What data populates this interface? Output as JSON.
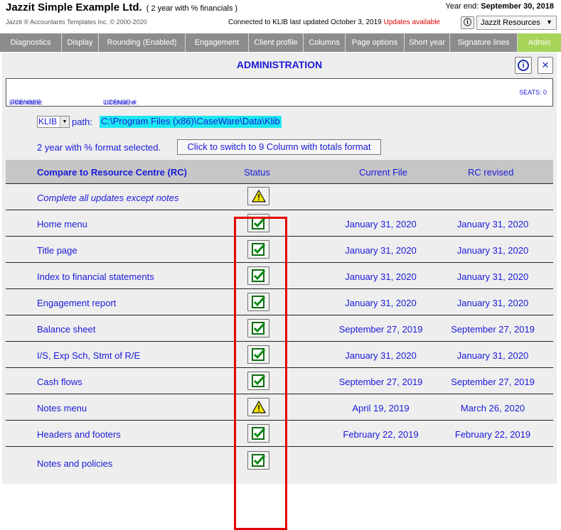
{
  "header": {
    "company": "Jazzit Simple Example Ltd.",
    "company_sub": "( 2 year with % financials )",
    "copyright": "Jazzit ® Accountants Templates Inc. © 2000-2020",
    "year_end_label": "Year end:",
    "year_end_value": "September 30, 2018",
    "connection": "Connected to KLIB last updated October 3, 2019",
    "updates": "Updates available",
    "info_icon": "ⓘ",
    "resources_select": "Jazzit Resources"
  },
  "tabs": [
    {
      "label": "Diagnostics"
    },
    {
      "label": "Display"
    },
    {
      "label": "Rounding (Enabled)"
    },
    {
      "label": "Engagement"
    },
    {
      "label": "Client profile"
    },
    {
      "label": "Columns"
    },
    {
      "label": "Page options"
    },
    {
      "label": "Short year"
    },
    {
      "label": "Signature lines"
    },
    {
      "label": "Admin"
    }
  ],
  "admin": {
    "title": "ADMINISTRATION",
    "info_glyph": "i",
    "close_glyph": "✕"
  },
  "license": {
    "licensee_label": "LICENSEE:",
    "licensee_value": "Firm name",
    "license_no_label": "LICENSE #:",
    "license_no_value": "License no",
    "seats": "SEATS: 0"
  },
  "klib": {
    "select_value": "KLIB",
    "path_label": "path:",
    "path_value": "C:\\Program Files (x86)\\CaseWare\\Data\\Klib"
  },
  "format": {
    "text": "2 year with % format selected.",
    "switch_button": "Click to switch to 9 Column with totals format"
  },
  "table": {
    "headers": {
      "name": "Compare to Resource Centre (RC)",
      "status": "Status",
      "current": "Current File",
      "rc": "RC revised"
    },
    "rows": [
      {
        "name": "Complete all updates except notes",
        "status": "warning",
        "current": "",
        "rc": ""
      },
      {
        "name": "Home menu",
        "status": "ok",
        "current": "January 31, 2020",
        "rc": "January 31, 2020"
      },
      {
        "name": "Title page",
        "status": "ok",
        "current": "January 31, 2020",
        "rc": "January 31, 2020"
      },
      {
        "name": "Index to financial statements",
        "status": "ok",
        "current": "January 31, 2020",
        "rc": "January 31, 2020"
      },
      {
        "name": "Engagement report",
        "status": "ok",
        "current": "January 31, 2020",
        "rc": "January 31, 2020"
      },
      {
        "name": "Balance sheet",
        "status": "ok",
        "current": "September 27, 2019",
        "rc": "September 27, 2019"
      },
      {
        "name": "I/S, Exp Sch, Stmt of R/E",
        "status": "ok",
        "current": "January 31, 2020",
        "rc": "January 31, 2020"
      },
      {
        "name": "Cash flows",
        "status": "ok",
        "current": "September 27, 2019",
        "rc": "September 27, 2019"
      },
      {
        "name": "Notes menu",
        "status": "warning",
        "current": "April 19, 2019",
        "rc": "March 26, 2020"
      },
      {
        "name": "Headers and footers",
        "status": "ok",
        "current": "February 22, 2019",
        "rc": "February 22, 2019"
      },
      {
        "name": "Notes and policies",
        "status": "ok",
        "current": "",
        "rc": ""
      }
    ]
  },
  "colors": {
    "link_blue": "#1a1ad9",
    "tab_gray": "#8c8c8c",
    "tab_active": "#a6d55a",
    "highlight_frame": "#e40000",
    "path_highlight": "#1ee8ef"
  }
}
